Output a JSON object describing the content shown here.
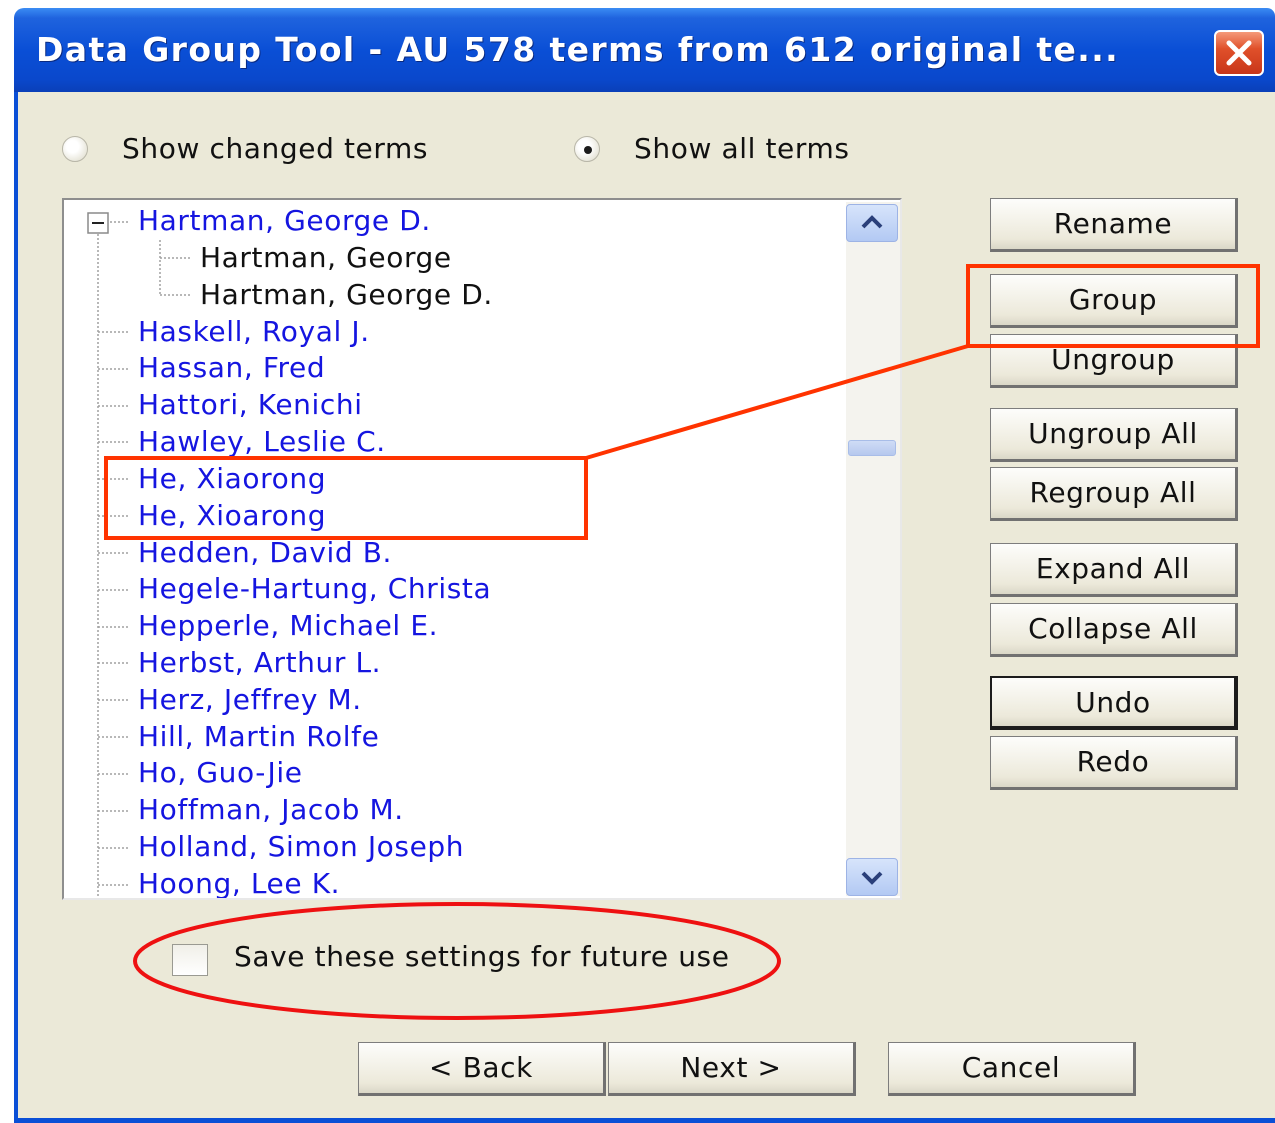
{
  "window": {
    "title": "Data Group Tool - AU  578 terms from 612 original te...",
    "close_icon": "close-x-icon"
  },
  "filter": {
    "options": [
      {
        "label": "Show changed terms",
        "selected": false
      },
      {
        "label": "Show all terms",
        "selected": true
      }
    ]
  },
  "tree": {
    "items": [
      {
        "label": "Hartman, George D.",
        "level": 0,
        "expanded": true,
        "color": "blue"
      },
      {
        "label": "Hartman, George",
        "level": 1,
        "color": "black"
      },
      {
        "label": "Hartman, George D.",
        "level": 1,
        "color": "black"
      },
      {
        "label": "Haskell, Royal J.",
        "level": 0,
        "color": "blue"
      },
      {
        "label": "Hassan, Fred",
        "level": 0,
        "color": "blue"
      },
      {
        "label": "Hattori, Kenichi",
        "level": 0,
        "color": "blue"
      },
      {
        "label": "Hawley, Leslie C.",
        "level": 0,
        "color": "blue"
      },
      {
        "label": "He, Xiaorong",
        "level": 0,
        "color": "blue"
      },
      {
        "label": "He, Xioarong",
        "level": 0,
        "color": "blue"
      },
      {
        "label": "Hedden, David B.",
        "level": 0,
        "color": "blue"
      },
      {
        "label": "Hegele-Hartung, Christa",
        "level": 0,
        "color": "blue"
      },
      {
        "label": "Hepperle, Michael E.",
        "level": 0,
        "color": "blue"
      },
      {
        "label": "Herbst, Arthur L.",
        "level": 0,
        "color": "blue"
      },
      {
        "label": "Herz, Jeffrey M.",
        "level": 0,
        "color": "blue"
      },
      {
        "label": "Hill, Martin Rolfe",
        "level": 0,
        "color": "blue"
      },
      {
        "label": "Ho, Guo-Jie",
        "level": 0,
        "color": "blue"
      },
      {
        "label": "Hoffman, Jacob M.",
        "level": 0,
        "color": "blue"
      },
      {
        "label": "Holland, Simon Joseph",
        "level": 0,
        "color": "blue"
      },
      {
        "label": "Hoong, Lee K.",
        "level": 0,
        "color": "blue"
      }
    ],
    "scroll_position": 0.36
  },
  "actions": {
    "rename": "Rename",
    "group": "Group",
    "ungroup": "Ungroup",
    "ungroup_all": "Ungroup All",
    "regroup_all": "Regroup All",
    "expand_all": "Expand All",
    "collapse_all": "Collapse All",
    "undo": "Undo",
    "redo": "Redo"
  },
  "save_settings": {
    "label": "Save these settings for future use",
    "checked": false
  },
  "footer": {
    "back": "< Back",
    "next": "Next >",
    "cancel": "Cancel"
  },
  "colors": {
    "title_bar": "#0a4fd6",
    "dialog_bg": "#ebe9d8",
    "term_blue": "#1515e0",
    "annotation_red": "#ff3300"
  }
}
